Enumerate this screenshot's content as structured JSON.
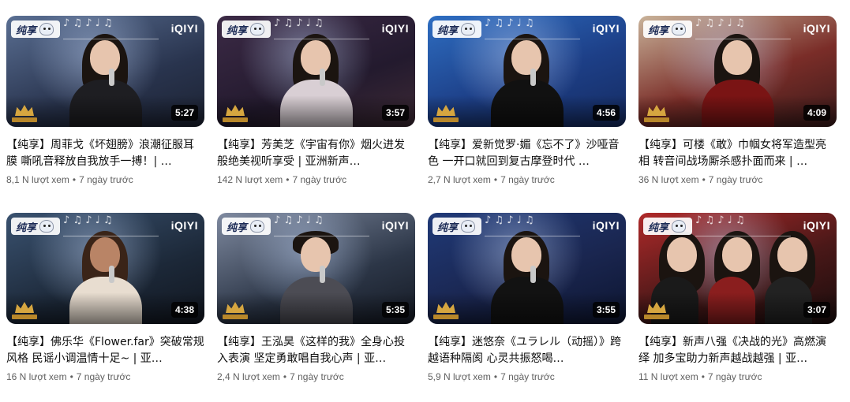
{
  "brand": {
    "tag": "纯享",
    "logo": "iQIYI",
    "mascot_icon": "mascot-icon",
    "show_logo_icon": "crown-logo-icon"
  },
  "videos": [
    {
      "title": "【纯享】周菲戈《坏翅膀》浪潮征服耳膜 嘶吼音释放自我放手一搏！| …",
      "views": "8,1 N lượt xem",
      "age": "7 ngày trước",
      "duration": "5:27"
    },
    {
      "title": "【纯享】芳美芝《宇宙有你》烟火进发般绝美视听享受 | 亚洲新声…",
      "views": "142 N lượt xem",
      "age": "7 ngày trước",
      "duration": "3:57"
    },
    {
      "title": "【纯享】爱新觉罗·媚《忘不了》沙哑音色 一开口就回到复古摩登时代 …",
      "views": "2,7 N lượt xem",
      "age": "7 ngày trước",
      "duration": "4:56"
    },
    {
      "title": "【纯享】可楼《敢》巾帼女将军造型亮相 转音间战场厮杀感扑面而来 | …",
      "views": "36 N lượt xem",
      "age": "7 ngày trước",
      "duration": "4:09"
    },
    {
      "title": "【纯享】佛乐华《Flower.far》突破常规风格 民谣小调温情十足~ | 亚…",
      "views": "16 N lượt xem",
      "age": "7 ngày trước",
      "duration": "4:38"
    },
    {
      "title": "【纯享】王泓昊《这样的我》全身心投入表演 坚定勇敢唱自我心声 | 亚…",
      "views": "2,4 N lượt xem",
      "age": "7 ngày trước",
      "duration": "5:35"
    },
    {
      "title": "【纯享】迷悠奈《ユラレル（动摇）》跨越语种隔阂 心灵共振怒喝…",
      "views": "5,9 N lượt xem",
      "age": "7 ngày trước",
      "duration": "3:55"
    },
    {
      "title": "【纯享】新声八强《决战的光》高燃演绎 加多宝助力新声越战越强 | 亚…",
      "views": "11 N lượt xem",
      "age": "7 ngày trước",
      "duration": "3:07"
    }
  ]
}
